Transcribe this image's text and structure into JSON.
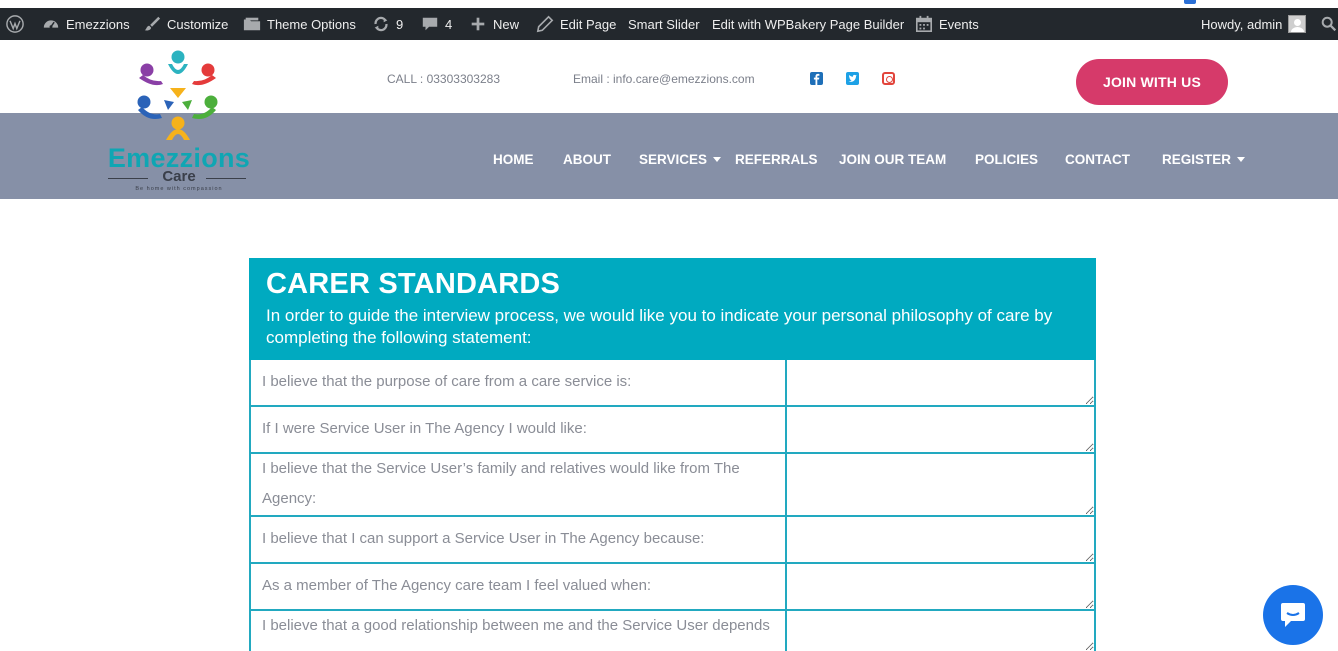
{
  "adminbar": {
    "site_name": "Emezzions",
    "customize": "Customize",
    "theme_options": "Theme Options",
    "updates_count": "9",
    "comments_count": "4",
    "new_label": "New",
    "edit_page": "Edit Page",
    "smart_slider": "Smart Slider",
    "wpbakery": "Edit with WPBakery Page Builder",
    "events": "Events",
    "howdy": "Howdy, admin"
  },
  "header": {
    "call": "CALL : 03303303283",
    "email": "Email : info.care@emezzions.com",
    "join_button": "JOIN WITH US",
    "logo": {
      "name": "Emezzions",
      "sub": "Care",
      "tagline": "Be home with compassion"
    }
  },
  "nav": {
    "items": [
      {
        "label": "HOME"
      },
      {
        "label": "ABOUT"
      },
      {
        "label": "SERVICES"
      },
      {
        "label": "REFERRALS"
      },
      {
        "label": "JOIN OUR TEAM"
      },
      {
        "label": "POLICIES"
      },
      {
        "label": "CONTACT"
      },
      {
        "label": "REGISTER"
      }
    ]
  },
  "form": {
    "title": "CARER STANDARDS",
    "intro": "In order to guide the interview process, we would like you to indicate your personal philosophy of care by completing the following statement:",
    "questions": [
      {
        "text": "I believe that the purpose of care from a care service is:",
        "answer": ""
      },
      {
        "text": "If I were Service User in The Agency I would like:",
        "answer": ""
      },
      {
        "text": "I believe that the Service User’s family and relatives would like from The Agency:",
        "answer": ""
      },
      {
        "text": "I believe that I can support a Service User in The Agency because:",
        "answer": ""
      },
      {
        "text": "As a member of The Agency care team I feel valued when:",
        "answer": ""
      },
      {
        "text": "I believe that a good relationship between me and the Service User depends on:",
        "answer": ""
      }
    ]
  },
  "colors": {
    "adminbar_bg": "#23282d",
    "nav_bg": "#8690a7",
    "form_header": "#00aac0",
    "join_button": "#d63a6a",
    "chat_button": "#1a73e8"
  },
  "icons": {
    "wp_logo": "wordpress-icon",
    "dashboard": "dashboard-icon",
    "customize": "paintbrush-icon",
    "theme_options": "folder-icon",
    "updates": "refresh-icon",
    "comments": "comment-icon",
    "new": "plus-icon",
    "edit": "pencil-icon",
    "events": "calendar-icon",
    "search": "search-icon",
    "chat": "chat-icon"
  }
}
